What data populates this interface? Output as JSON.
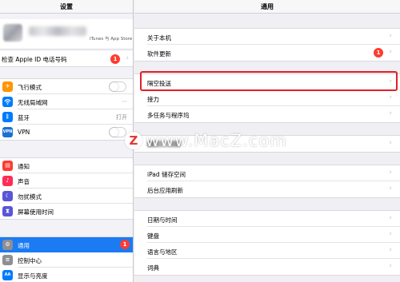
{
  "sidebar": {
    "title": "设置",
    "profile_subtitle": "iTunes 与 App Store",
    "apple_id_row": {
      "label": "检查 Apple ID 电话号码",
      "badge": "1"
    },
    "group1": [
      {
        "label": "飞行模式",
        "icon": "airplane-icon",
        "color": "#ff9500",
        "control": "toggle",
        "state": "off"
      },
      {
        "label": "无线局域网",
        "icon": "wifi-icon",
        "color": "#007aff",
        "value": "⋯"
      },
      {
        "label": "蓝牙",
        "icon": "bluetooth-icon",
        "color": "#007aff",
        "value": "打开"
      },
      {
        "label": "VPN",
        "icon": "vpn-icon",
        "color": "#1c6fd1",
        "control": "toggle",
        "state": "off"
      }
    ],
    "group2": [
      {
        "label": "通知",
        "icon": "notifications-icon",
        "color": "#ff3b30"
      },
      {
        "label": "声音",
        "icon": "sound-icon",
        "color": "#ff2d55"
      },
      {
        "label": "勿扰模式",
        "icon": "moon-icon",
        "color": "#5856d6"
      },
      {
        "label": "屏幕使用时间",
        "icon": "hourglass-icon",
        "color": "#5856d6"
      }
    ],
    "group3": [
      {
        "label": "通用",
        "icon": "gear-icon",
        "color": "#8e8e93",
        "active": true,
        "badge": "1"
      },
      {
        "label": "控制中心",
        "icon": "control-center-icon",
        "color": "#8e8e93"
      },
      {
        "label": "显示与亮度",
        "icon": "display-icon",
        "color": "#007aff"
      }
    ]
  },
  "main": {
    "title": "通用",
    "group1": [
      {
        "label": "关于本机"
      },
      {
        "label": "软件更新",
        "badge": "1"
      }
    ],
    "group2": [
      {
        "label": "隔空投送",
        "highlighted": true
      },
      {
        "label": "接力"
      },
      {
        "label": "多任务与程序坞"
      }
    ],
    "group4": [
      {
        "label": "iPad 储存空间"
      },
      {
        "label": "后台应用刷新"
      }
    ],
    "group5": [
      {
        "label": "日期与时间"
      },
      {
        "label": "键盘"
      },
      {
        "label": "语言与地区"
      },
      {
        "label": "词典"
      }
    ]
  },
  "watermark": {
    "logo": "Z",
    "text": "www.MacZ.com"
  },
  "colors": {
    "accent": "#1a7bf2",
    "badge": "#ff3b30",
    "highlight": "#e51d24"
  }
}
